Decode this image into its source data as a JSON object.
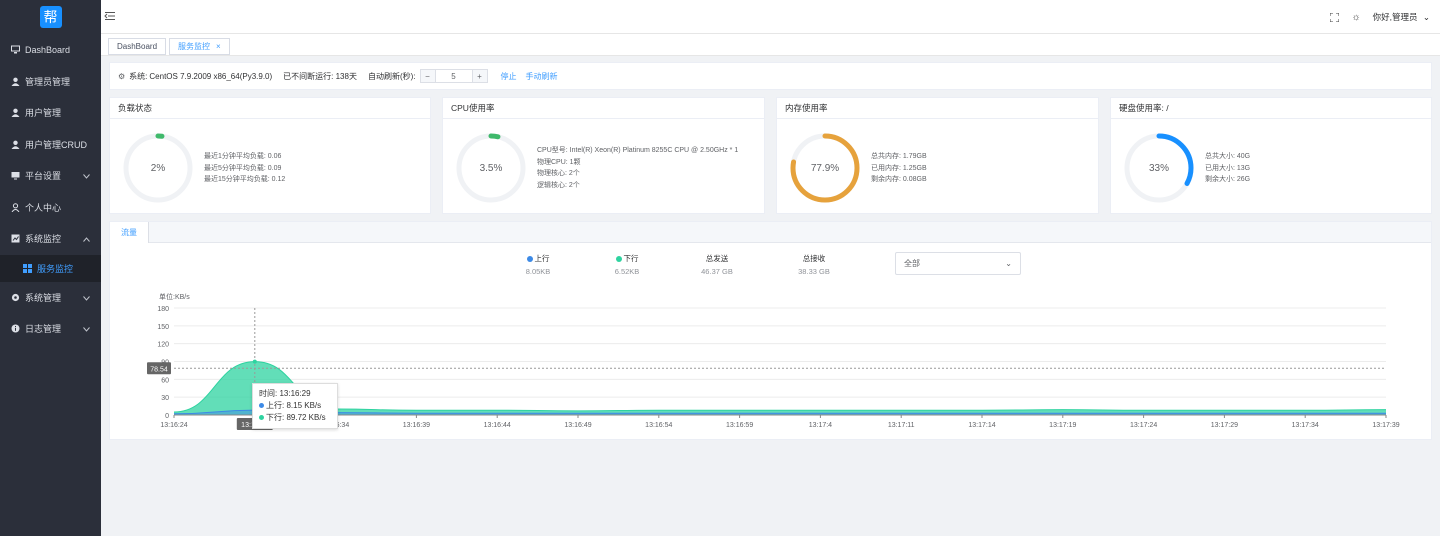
{
  "app": {
    "logo_char": "帮"
  },
  "sidebar": {
    "items": [
      {
        "label": "DashBoard",
        "icon": "dashboard-icon"
      },
      {
        "label": "管理员管理",
        "icon": "user-icon"
      },
      {
        "label": "用户管理",
        "icon": "user-icon"
      },
      {
        "label": "用户管理CRUD",
        "icon": "user-icon"
      },
      {
        "label": "平台设置",
        "icon": "monitor-icon",
        "expandable": true
      },
      {
        "label": "个人中心",
        "icon": "person-icon"
      },
      {
        "label": "系统监控",
        "icon": "chart-icon",
        "expandable": true,
        "expanded": true
      },
      {
        "label": "服务监控",
        "icon": "grid-icon",
        "sub": true,
        "active": true
      },
      {
        "label": "系统管理",
        "icon": "gear-icon",
        "expandable": true
      },
      {
        "label": "日志管理",
        "icon": "info-icon",
        "expandable": true
      }
    ]
  },
  "topbar": {
    "greeting": "你好,管理员"
  },
  "tabs": [
    {
      "label": "DashBoard",
      "active": false
    },
    {
      "label": "服务监控",
      "active": true,
      "closable": true
    }
  ],
  "system": {
    "os_label": "系统:",
    "os_value": "CentOS 7.9.2009 x86_64(Py3.9.0)",
    "uptime": "已不间断运行: 138天",
    "refresh_label": "自动刷新(秒):",
    "refresh_value": "5",
    "minus": "−",
    "plus": "+",
    "stop": "停止",
    "manual_refresh": "手动刷新"
  },
  "cards": {
    "load": {
      "title": "负载状态",
      "value": "2%",
      "percent": 2,
      "color": "#3fb96b",
      "lines": [
        "最近1分钟平均负载: 0.06",
        "最近5分钟平均负载: 0.09",
        "最近15分钟平均负载: 0.12"
      ]
    },
    "cpu": {
      "title": "CPU使用率",
      "value": "3.5%",
      "percent": 3.5,
      "color": "#3fb96b",
      "lines": [
        "CPU型号: Intel(R) Xeon(R) Platinum 8255C CPU @ 2.50GHz * 1",
        "物理CPU: 1颗",
        "物理核心: 2个",
        "逻辑核心: 2个"
      ]
    },
    "mem": {
      "title": "内存使用率",
      "value": "77.9%",
      "percent": 77.9,
      "color": "#e6a23c",
      "lines": [
        "总共内存: 1.79GB",
        "已用内存: 1.25GB",
        "剩余内存: 0.08GB"
      ]
    },
    "disk": {
      "title": "硬盘使用率:  /",
      "value": "33%",
      "percent": 33,
      "color": "#1890ff",
      "lines": [
        "总共大小: 40G",
        "已用大小: 13G",
        "剩余大小: 26G"
      ]
    }
  },
  "traffic": {
    "tab": "流量",
    "up_label": "上行",
    "up_value": "8.05KB",
    "down_label": "下行",
    "down_value": "6.52KB",
    "sent_label": "总发送",
    "sent_value": "46.37 GB",
    "recv_label": "总接收",
    "recv_value": "38.33 GB",
    "select_value": "全部",
    "up_color": "#3d8ae6",
    "down_color": "#2ed3a0",
    "tooltip": {
      "time": "时间: 13:16:29",
      "up": "上行: 8.15 KB/s",
      "down": "下行: 89.72 KB/s"
    },
    "crosshair_y_label": "78.54",
    "crosshair_x_label": "13:16:29"
  },
  "chart_data": {
    "type": "area",
    "ylabel": "单位:KB/s",
    "ylim": [
      0,
      180
    ],
    "yticks": [
      0,
      30,
      60,
      90,
      120,
      150,
      180
    ],
    "x": [
      "13:16:24",
      "13:16:29",
      "13:16:34",
      "13:16:39",
      "13:16:44",
      "13:16:49",
      "13:16:54",
      "13:16:59",
      "13:17:4",
      "13:17:11",
      "13:17:14",
      "13:17:19",
      "13:17:24",
      "13:17:29",
      "13:17:34",
      "13:17:39"
    ],
    "series": [
      {
        "name": "上行",
        "values": [
          2,
          8.15,
          4,
          3,
          3,
          3,
          3,
          3,
          3,
          3,
          3,
          3,
          3,
          3,
          3,
          3
        ]
      },
      {
        "name": "下行",
        "values": [
          5,
          89.72,
          10,
          8,
          8,
          7,
          8,
          8,
          8,
          8,
          8,
          9,
          8,
          8,
          8,
          9
        ]
      }
    ]
  }
}
